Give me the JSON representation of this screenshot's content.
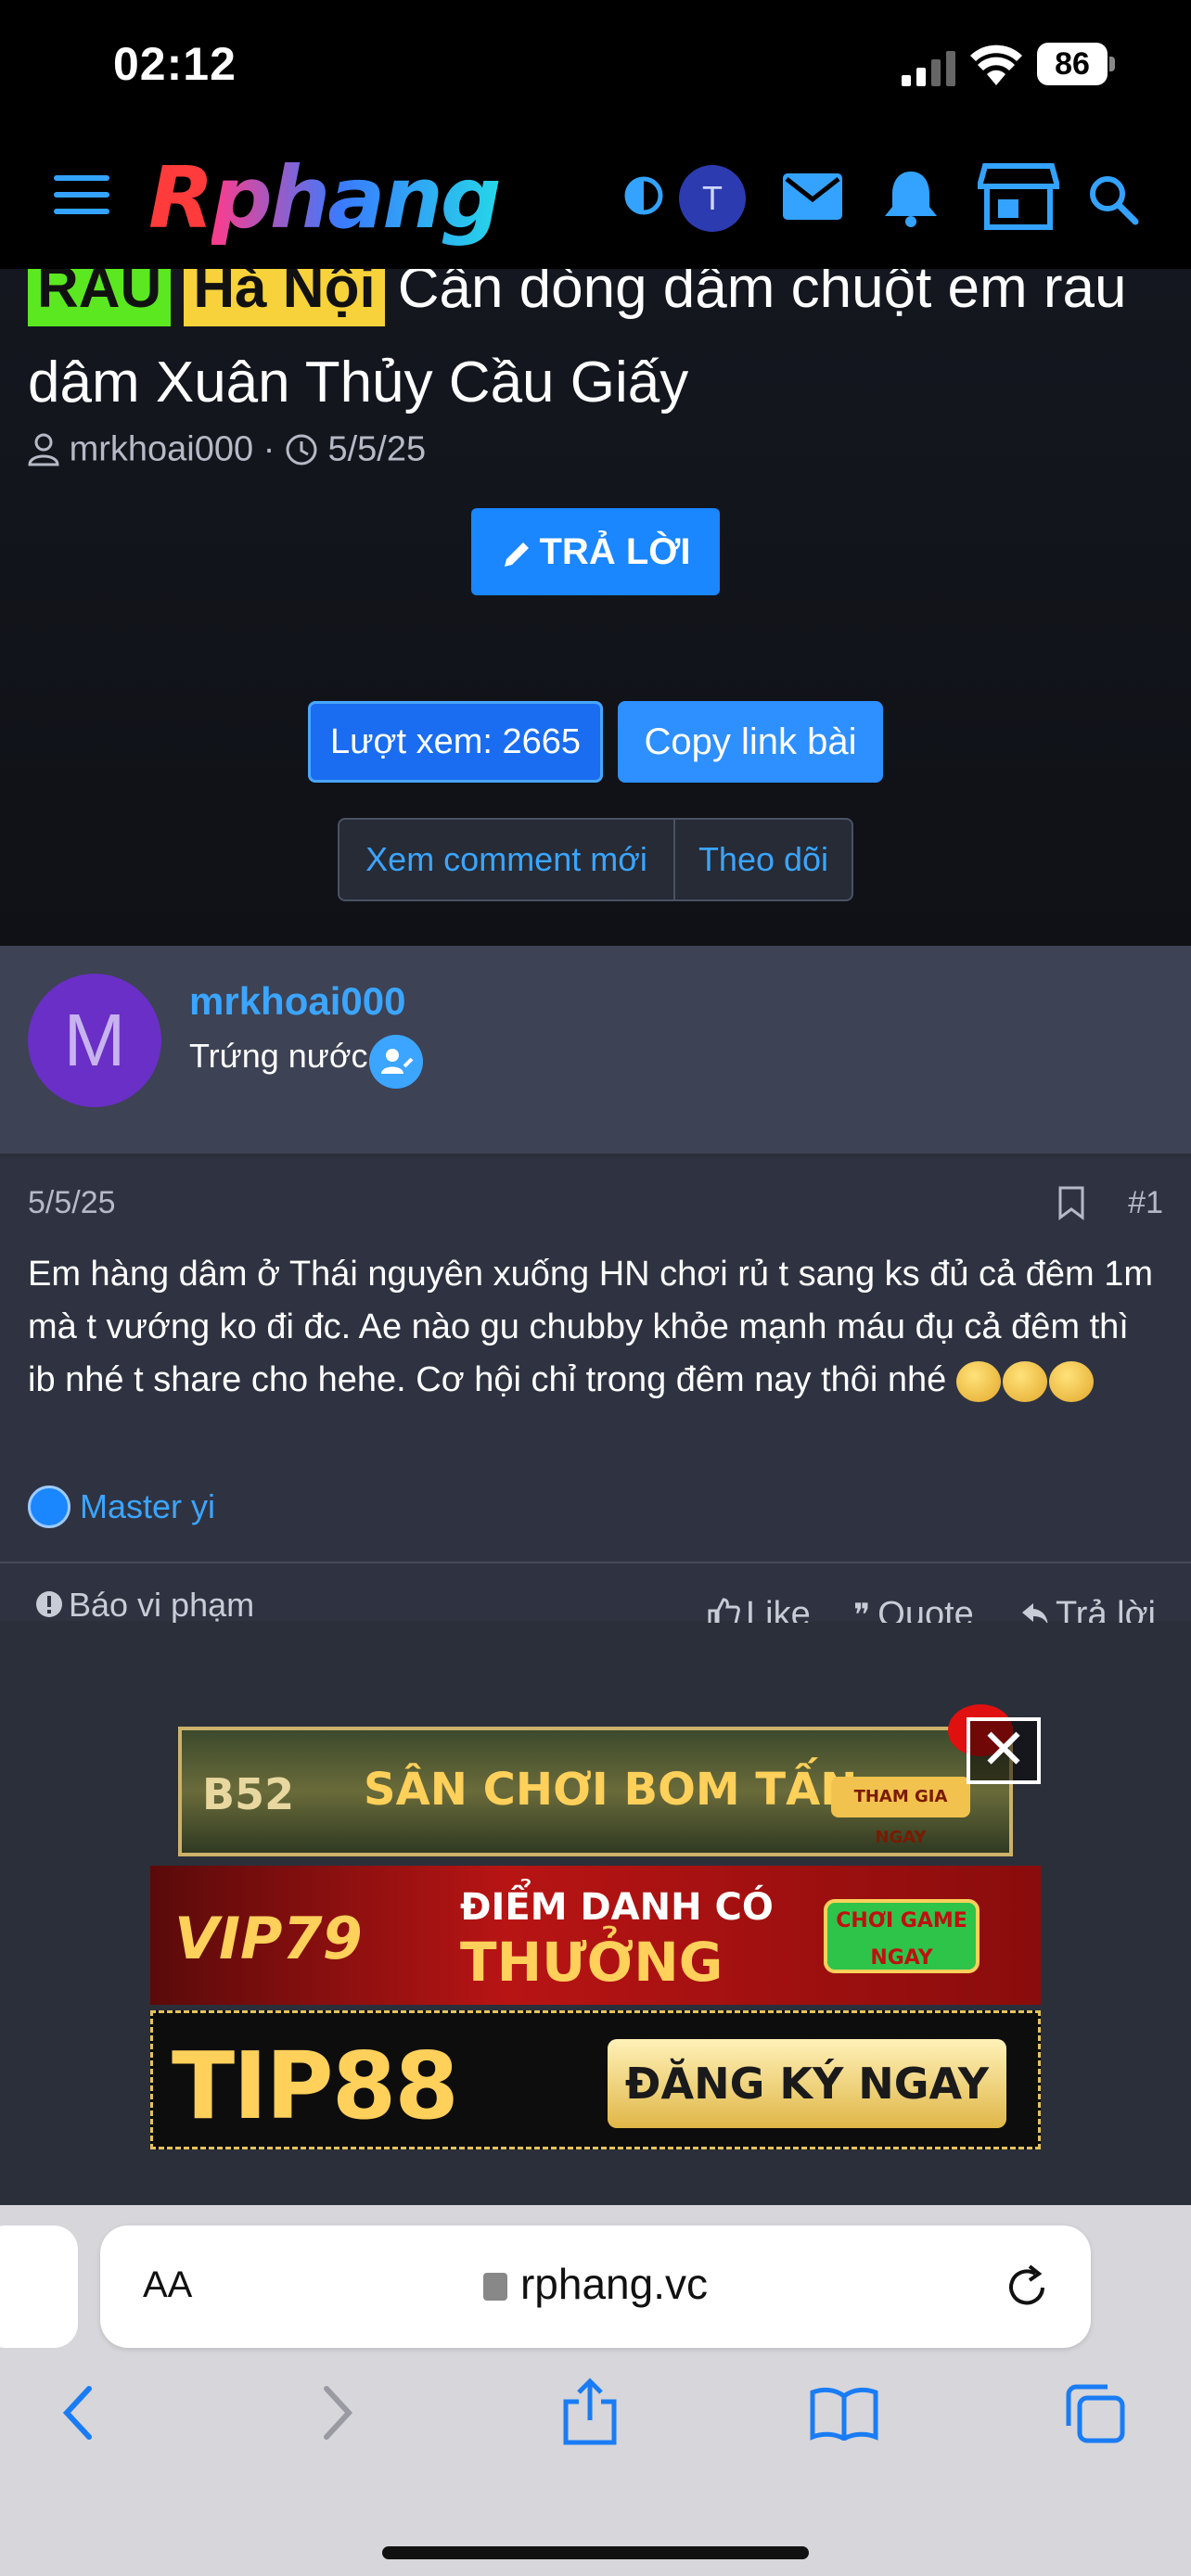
{
  "status_bar": {
    "time": "02:12",
    "battery": "86"
  },
  "header": {
    "logo_first": "R",
    "logo_rest": "phang",
    "user_initial": "T"
  },
  "thread": {
    "tags": [
      "RAU",
      "Hà Nội"
    ],
    "title": "Cần dòng dâm chuột em rau dâm Xuân Thủy Cầu Giấy",
    "author": "mrkhoai000",
    "date": "5/5/25",
    "reply_button": "TRẢ LỜI",
    "views_button": "Lượt xem: 2665",
    "copy_button": "Copy link bài",
    "new_comments_button": "Xem comment mới",
    "follow_button": "Theo dõi"
  },
  "post": {
    "user_initial": "M",
    "username": "mrkhoai000",
    "user_title": "Trứng nước",
    "date": "5/5/25",
    "number": "#1",
    "text": "Em hàng dâm ở Thái nguyên xuống HN chơi rủ t sang ks đủ cả đêm 1m mà t vướng ko đi đc. Ae nào gu chubby khỏe mạnh máu đụ cả đêm thì ib nhé t share cho hehe. Cơ hội chỉ trong đêm nay thôi nhé",
    "reaction_user": "Master yi",
    "report_label": "Báo vi phạm",
    "like_label": "Like",
    "quote_label": "Quote",
    "reply_label": "Trả lời"
  },
  "ads": {
    "ad1_brand": "B52",
    "ad1_text": "SÂN CHƠI BOM TẤN",
    "ad1_cta": "THAM GIA NGAY",
    "ad2_brand": "VIP79",
    "ad2_line1": "ĐIỂM DANH CÓ",
    "ad2_line2": "THƯỞNG",
    "ad2_cta": "CHƠI GAME NGAY",
    "ad3_brand": "TIP88",
    "ad3_cta": "ĐĂNG KÝ NGAY",
    "close": "✕"
  },
  "browser": {
    "text_size": "AA",
    "url": "rphang.vc"
  }
}
